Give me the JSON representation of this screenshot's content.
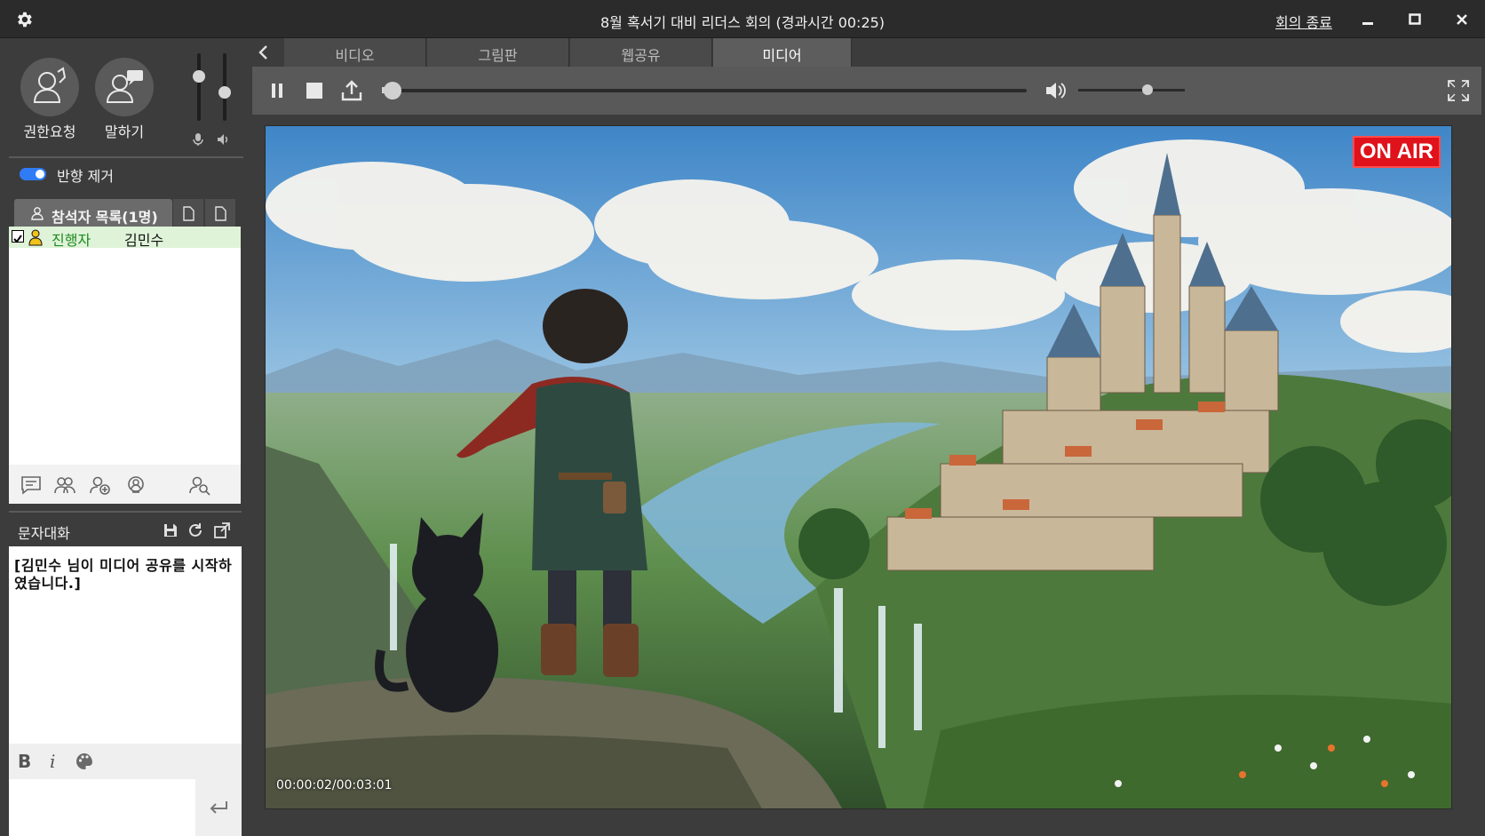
{
  "window": {
    "title": "8월 혹서기 대비 리더스 회의 (경과시간 00:25)",
    "end_meeting": "회의 종료"
  },
  "left": {
    "request_label": "권한요청",
    "speak_label": "말하기",
    "echo_cancel_label": "반향 제거",
    "echo_cancel_on": true,
    "mic_level": 0.7,
    "speaker_level": 0.4,
    "participants_tab": "참석자 목록(1명)",
    "participants": [
      {
        "role": "진행자",
        "name": "김민수"
      }
    ],
    "chat_title": "문자대화",
    "chat_messages": [
      "[김민수 님이 미디어 공유를 시작하였습니다.]"
    ],
    "format_bold": "B",
    "format_italic": "i",
    "chat_input_value": ""
  },
  "tabs": [
    {
      "label": "비디오",
      "active": false
    },
    {
      "label": "그림판",
      "active": false
    },
    {
      "label": "웹공유",
      "active": false
    },
    {
      "label": "미디어",
      "active": true
    }
  ],
  "player": {
    "progress": 0.011,
    "volume": 0.65,
    "on_air": "ON AIR",
    "timecode": "00:00:02/00:03:01"
  },
  "colors": {
    "accent": "#2f7cf6",
    "on_air": "#e0121b",
    "host_role": "#1d8b1d"
  }
}
